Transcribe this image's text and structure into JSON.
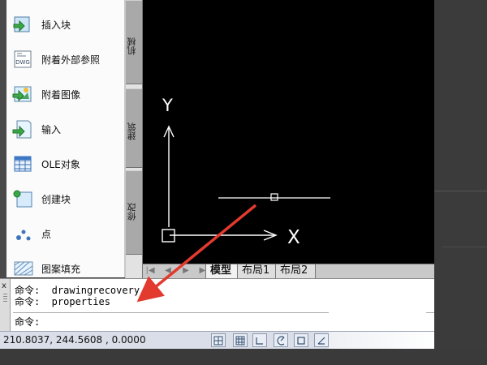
{
  "palette": {
    "items": [
      {
        "label": "插入块",
        "icon": "insert-block-icon"
      },
      {
        "label": "附着外部参照",
        "icon": "dwg-reference-icon"
      },
      {
        "label": "附着图像",
        "icon": "image-icon"
      },
      {
        "label": "输入",
        "icon": "import-icon"
      },
      {
        "label": "OLE对象",
        "icon": "ole-object-icon"
      },
      {
        "label": "创建块",
        "icon": "create-block-icon"
      },
      {
        "label": "点",
        "icon": "point-icon"
      },
      {
        "label": "图案填充",
        "icon": "hatch-icon"
      }
    ],
    "dwg_icon_text": "DWG"
  },
  "side_tabs": {
    "tab1": "机械",
    "tab2": "建筑",
    "tab3": "修改"
  },
  "drawing": {
    "x_axis_label": "X",
    "y_axis_label": "Y",
    "background": "#000000",
    "line_color": "#ffffff",
    "arrow_color": "#e23a2f"
  },
  "layout_tabs": {
    "nav_first": "|◀",
    "nav_prev": "◀",
    "nav_next": "▶",
    "nav_last": "▶|",
    "tabs": [
      "模型",
      "布局1",
      "布局2"
    ]
  },
  "command": {
    "close": "x",
    "line1": "命令:  drawingrecovery",
    "line2": "命令:  properties",
    "prompt": "命令:"
  },
  "status": {
    "coordinates": "210.8037,  244.5608 , 0.0000",
    "buttons": [
      "snap-icon",
      "grid-icon",
      "ortho-icon",
      "polar-icon",
      "osnap-icon",
      "otrack-icon"
    ]
  }
}
